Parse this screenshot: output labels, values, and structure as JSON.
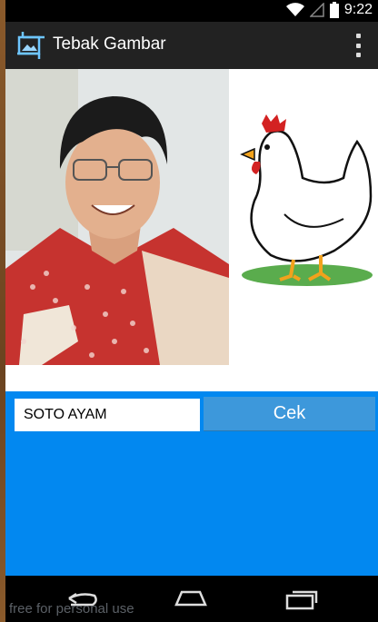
{
  "status_bar": {
    "time": "9:22"
  },
  "action_bar": {
    "title": "Tebak Gambar",
    "icon": "photo-crop-icon",
    "overflow_icon": "overflow-menu-icon"
  },
  "images": {
    "left": "person-photo",
    "right": "chicken-illustration"
  },
  "answer": {
    "value": "SOTO AYAM"
  },
  "check_button": {
    "label": "Cek"
  },
  "nav": {
    "back_icon": "back-icon",
    "home_icon": "home-icon",
    "recents_icon": "recents-icon"
  },
  "watermark": "free for personal use",
  "colors": {
    "accent": "#0288f0",
    "button": "#3d98db",
    "actionbar": "#222222"
  }
}
